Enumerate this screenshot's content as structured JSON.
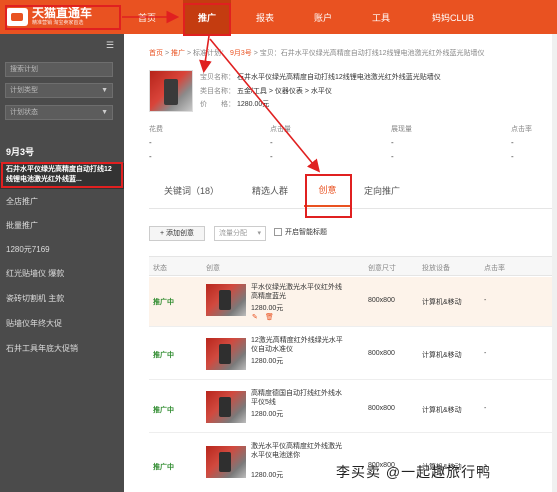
{
  "topbar": {
    "logo_main": "天猫直通车",
    "logo_sub": "精准营销 淘宝卖家首选",
    "nav": [
      "首页",
      "推广",
      "报表",
      "账户",
      "工具",
      "妈妈CLUB"
    ],
    "active_nav": "推广"
  },
  "sidebar": {
    "toggle_icon": "menu-collapse-icon",
    "search_placeholder": "搜索计划",
    "plan_type": "计划类型",
    "plan_status": "计划状态",
    "current_plan": "9月3号",
    "active_item": "石井水平仪绿光高精度自动打线12线锂电池激光红外线蓝...",
    "items": [
      "全店推广",
      "批量推广",
      "1280元7169",
      "红光贴墙仪 爆款",
      "瓷砖切割机 主款",
      "贴墙仪年终大促",
      "石井工具年底大促销"
    ]
  },
  "breadcrumb": {
    "home": "首页",
    "sep": ">",
    "promo": "推广",
    "plan_label": "标准计划：",
    "plan": "9月3号",
    "item": "宝贝：石井水平仪绿光高精度自动打线12线锂电池激光红外线蓝光贴墙仪"
  },
  "product": {
    "name_label": "宝贝名称：",
    "name": "石井水平仪绿光高精度自动打线12线锂电池激光红外线蓝光贴墙仪",
    "category_label": "类目名称：",
    "category": "五金/工具 > 仪器仪表 > 水平仪",
    "price_label": "价　　格：",
    "price": "1280.00元"
  },
  "stats": {
    "labels": [
      "花费",
      "点击量",
      "展现量",
      "点击率"
    ],
    "values": [
      "-",
      "-",
      "-",
      "-"
    ]
  },
  "tabs": {
    "keywords": "关键词（18）",
    "audience": "精选人群",
    "creative": "创意",
    "targeted": "定向推广"
  },
  "toolbar": {
    "add_creative": "+ 添加创意",
    "flow_select": "流量分配",
    "smart_creative": "开启智能标题"
  },
  "table": {
    "headers": [
      "状态",
      "创意",
      "创意尺寸",
      "投放设备",
      "点击率"
    ],
    "rows": [
      {
        "status": "推广中",
        "title": "平水仪绿光激光水平仪红外线高精度蓝光",
        "price": "1280.00元",
        "size": "800x800",
        "device": "计算机&移动",
        "ctr": "-"
      },
      {
        "status": "推广中",
        "title": "12激光高精度红外线绿光水平仪自动水准仪",
        "price": "1280.00元",
        "size": "800x800",
        "device": "计算机&移动",
        "ctr": "-"
      },
      {
        "status": "推广中",
        "title": "高精度德国自动打线红外线水平仪5线",
        "price": "1280.00元",
        "size": "800x800",
        "device": "计算机&移动",
        "ctr": "-"
      },
      {
        "status": "推广中",
        "title": "激光水平仪高精度红外线激光水平仪电池迷你",
        "price": "1280.00元",
        "size": "800x800",
        "device": "计算机&移动",
        "ctr": "-"
      }
    ],
    "edit_icon": "edit-icon",
    "delete_icon": "trash-icon"
  },
  "watermark": "李买卖 @一起趣旅行鸭"
}
